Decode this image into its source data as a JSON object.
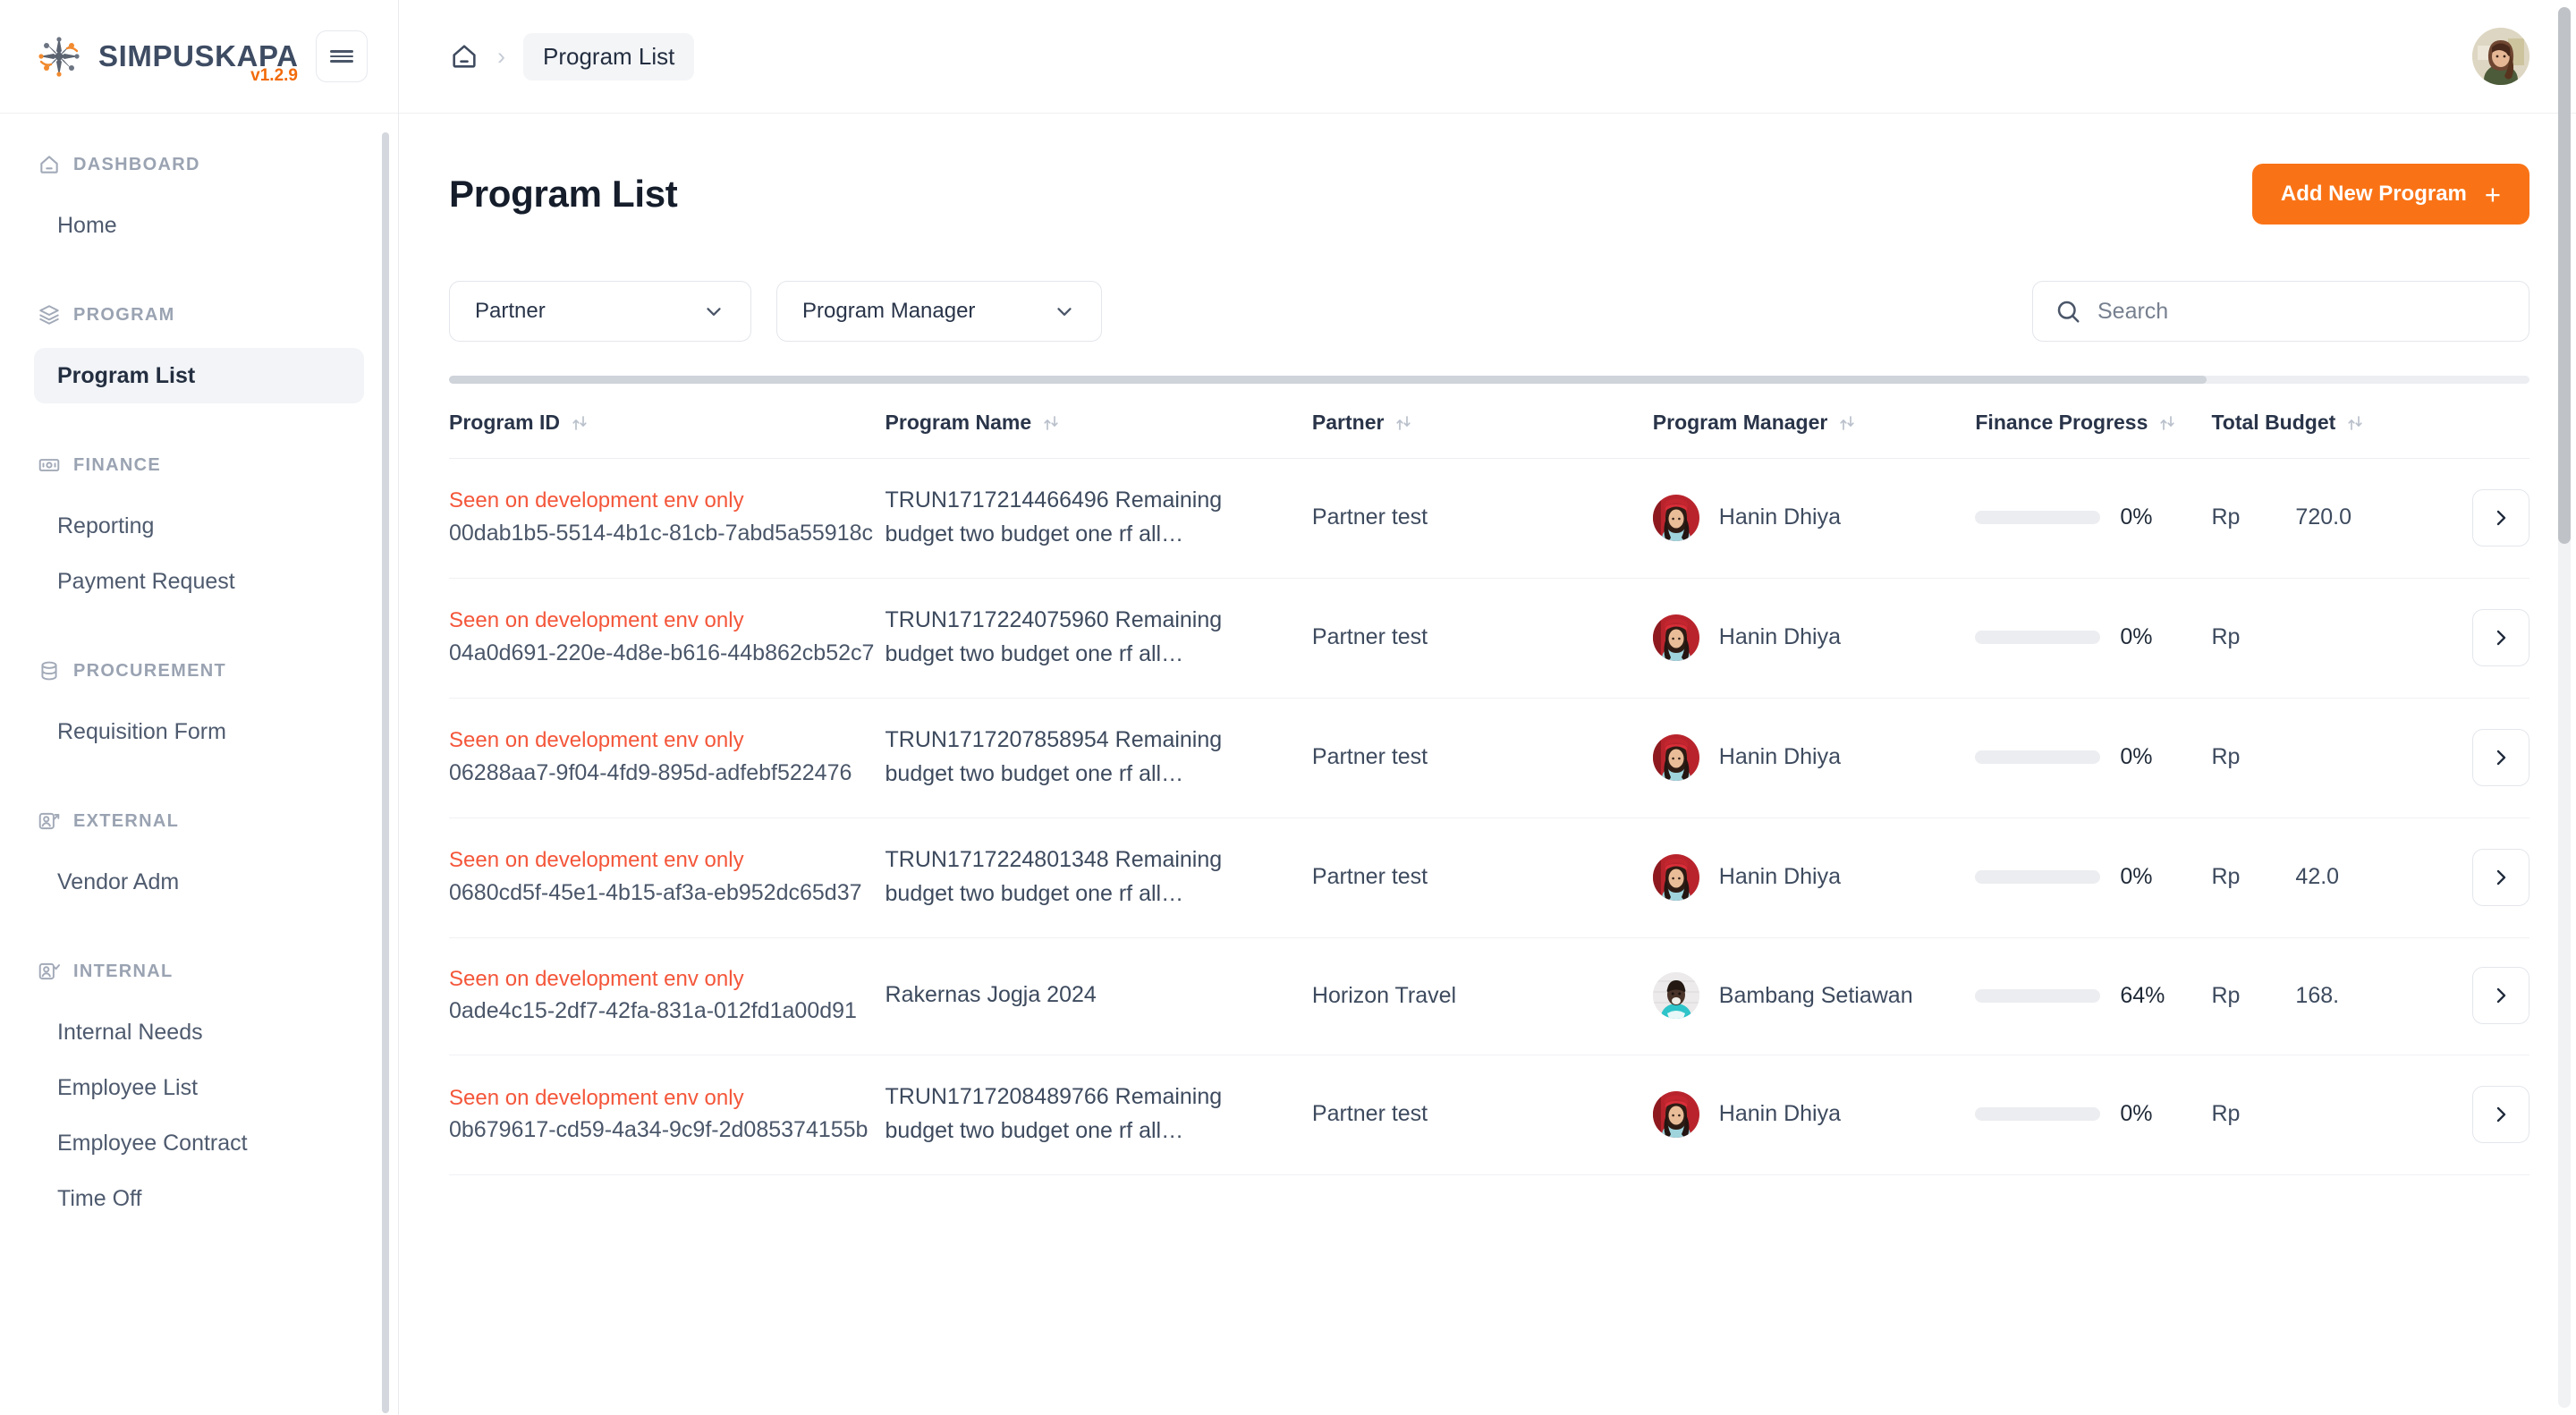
{
  "brand": {
    "name": "SIMPUSKAPA",
    "version": "v1.2.9",
    "logo_icon": "starburst-people-logo",
    "menu_icon": "hamburger-icon"
  },
  "sidebar": {
    "groups": [
      {
        "section": "DASHBOARD",
        "section_icon": "home-icon",
        "items": [
          {
            "label": "Home",
            "active": false
          }
        ]
      },
      {
        "section": "PROGRAM",
        "section_icon": "layers-icon",
        "items": [
          {
            "label": "Program List",
            "active": true
          }
        ]
      },
      {
        "section": "FINANCE",
        "section_icon": "banknote-icon",
        "items": [
          {
            "label": "Reporting",
            "active": false
          },
          {
            "label": "Payment Request",
            "active": false
          }
        ]
      },
      {
        "section": "PROCUREMENT",
        "section_icon": "database-icon",
        "items": [
          {
            "label": "Requisition Form",
            "active": false
          }
        ]
      },
      {
        "section": "EXTERNAL",
        "section_icon": "user-arrow-icon",
        "items": [
          {
            "label": "Vendor Adm",
            "active": false
          }
        ]
      },
      {
        "section": "INTERNAL",
        "section_icon": "user-check-icon",
        "items": [
          {
            "label": "Internal Needs",
            "active": false
          },
          {
            "label": "Employee List",
            "active": false
          },
          {
            "label": "Employee Contract",
            "active": false
          },
          {
            "label": "Time Off",
            "active": false
          }
        ]
      }
    ]
  },
  "topbar": {
    "home_icon": "home-icon",
    "separator": "›",
    "breadcrumb_current": "Program List",
    "avatar_icon": "user-avatar"
  },
  "page": {
    "title": "Program List",
    "add_button_label": "Add New Program",
    "add_button_icon": "plus-icon",
    "accent_color": "#F97316"
  },
  "filters": {
    "partner": {
      "label": "Partner",
      "icon": "chevron-down-icon"
    },
    "program_manager": {
      "label": "Program Manager",
      "icon": "chevron-down-icon"
    },
    "search": {
      "placeholder": "Search",
      "value": "",
      "icon": "search-icon"
    }
  },
  "table": {
    "sort_icon": "sort-updown-icon",
    "row_action_icon": "chevron-right-icon",
    "progress_color": "#FFC220",
    "dev_note_color": "#F4563A",
    "columns": [
      "Program ID",
      "Program Name",
      "Partner",
      "Program Manager",
      "Finance Progress",
      "Total Budget"
    ],
    "rows": [
      {
        "dev_note": "Seen on development env only",
        "program_id": "00dab1b5-5514-4b1c-81cb-7abd5a55918c",
        "program_name": "TRUN1717214466496 Remaining budget two budget one rf all…",
        "partner": "Partner test",
        "program_manager": "Hanin Dhiya",
        "manager_avatar": "avatar-hanin",
        "finance_progress": 0,
        "finance_progress_label": "0%",
        "currency": "Rp",
        "total_budget": "720.0"
      },
      {
        "dev_note": "Seen on development env only",
        "program_id": "04a0d691-220e-4d8e-b616-44b862cb52c7",
        "program_name": "TRUN1717224075960 Remaining budget two budget one rf all…",
        "partner": "Partner test",
        "program_manager": "Hanin Dhiya",
        "manager_avatar": "avatar-hanin",
        "finance_progress": 0,
        "finance_progress_label": "0%",
        "currency": "Rp",
        "total_budget": ""
      },
      {
        "dev_note": "Seen on development env only",
        "program_id": "06288aa7-9f04-4fd9-895d-adfebf522476",
        "program_name": "TRUN1717207858954 Remaining budget two budget one rf all…",
        "partner": "Partner test",
        "program_manager": "Hanin Dhiya",
        "manager_avatar": "avatar-hanin",
        "finance_progress": 0,
        "finance_progress_label": "0%",
        "currency": "Rp",
        "total_budget": ""
      },
      {
        "dev_note": "Seen on development env only",
        "program_id": "0680cd5f-45e1-4b15-af3a-eb952dc65d37",
        "program_name": "TRUN1717224801348 Remaining budget two budget one rf all…",
        "partner": "Partner test",
        "program_manager": "Hanin Dhiya",
        "manager_avatar": "avatar-hanin",
        "finance_progress": 0,
        "finance_progress_label": "0%",
        "currency": "Rp",
        "total_budget": "42.0"
      },
      {
        "dev_note": "Seen on development env only",
        "program_id": "0ade4c15-2df7-42fa-831a-012fd1a00d91",
        "program_name": "Rakernas Jogja 2024",
        "partner": "Horizon Travel",
        "program_manager": "Bambang Setiawan",
        "manager_avatar": "avatar-bambang",
        "finance_progress": 64,
        "finance_progress_label": "64%",
        "currency": "Rp",
        "total_budget": "168."
      },
      {
        "dev_note": "Seen on development env only",
        "program_id": "0b679617-cd59-4a34-9c9f-2d085374155b",
        "program_name": "TRUN1717208489766 Remaining budget two budget one rf all…",
        "partner": "Partner test",
        "program_manager": "Hanin Dhiya",
        "manager_avatar": "avatar-hanin",
        "finance_progress": 0,
        "finance_progress_label": "0%",
        "currency": "Rp",
        "total_budget": ""
      }
    ]
  }
}
